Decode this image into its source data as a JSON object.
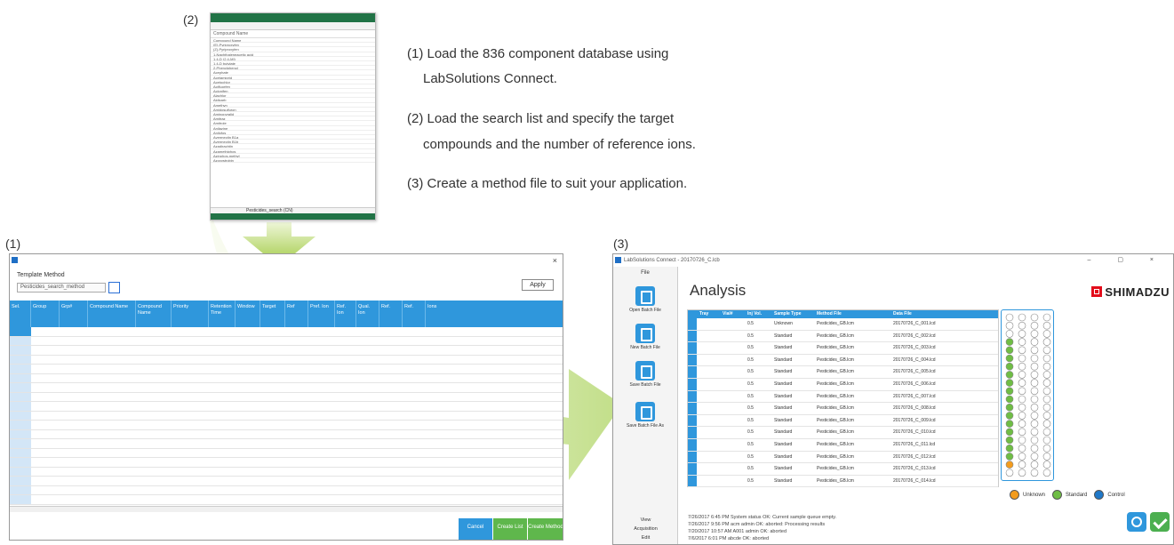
{
  "labels": {
    "l1": "(1)",
    "l2": "(2)",
    "l3": "(3)"
  },
  "steps": [
    "(1) Load the 836 component database using",
    "LabSolutions Connect.",
    "(2) Load the search list and specify the target",
    "compounds and the number of reference ions.",
    "(3) Create a method file to suit your application."
  ],
  "excel": {
    "formula_value": "Compound Name",
    "sheet_tab": "Pesticides_search (CN)",
    "rows": [
      "Compound Name",
      "(E)-Pyriproxyfen",
      "(Z)-Pyriproxyfen",
      "1-Naphthaleneacetic acid",
      "1,4-D (2,4-MI)",
      "1,4-D butylate",
      "2-Phenylphenol",
      "Acephate",
      "Acetamiprid",
      "Acetochlor",
      "Acifluorfen",
      "Aclonifen",
      "Alachlor",
      "Aldicarb",
      "Amethyn",
      "Amidosulfuron",
      "Aminopyralid",
      "Amitraz",
      "Amitrole",
      "Anilazine",
      "Anilofos",
      "Avermectin B1a",
      "Avermectin B1b",
      "Azadirachtin",
      "Azamethiphos",
      "Azinphos-methyl",
      "Azoxystrobin"
    ]
  },
  "win1": {
    "title": "Template Method",
    "select_value": "Pesticides_search_method",
    "button": "Apply",
    "headers": [
      "Sel.",
      "Group",
      "Grp#",
      "Compound Name",
      "Compound Name",
      "Priority",
      "Retention Time",
      "Window",
      "Target",
      "Ref",
      "Pref. Ion",
      "Ref. Ion",
      "Qual. Ion",
      "Ref.",
      "Ref.",
      "Ions"
    ],
    "buttons": [
      "Cancel",
      "Create List",
      "Create Method"
    ]
  },
  "win3": {
    "title": "LabSolutions Connect - 20170726_C.lcb",
    "menu": "File",
    "heading": "Analysis",
    "brand": "SHIMADZU",
    "side_buttons": [
      "Open Batch File",
      "New Batch File",
      "Save Batch File",
      "Save Batch File As"
    ],
    "nav": [
      "View",
      "Acquisition",
      "Edit"
    ],
    "cols": [
      "Tray",
      "Vial#",
      "Inj Vol.",
      "Sample Type",
      "Method File",
      "Data File"
    ],
    "rows": [
      [
        "",
        "",
        "0.5",
        "Unknown",
        "Pesticides_GB.lcm",
        "20170726_C_001.lcd"
      ],
      [
        "",
        "",
        "0.5",
        "Standard",
        "Pesticides_GB.lcm",
        "20170726_C_002.lcd"
      ],
      [
        "",
        "",
        "0.5",
        "Standard",
        "Pesticides_GB.lcm",
        "20170726_C_003.lcd"
      ],
      [
        "",
        "",
        "0.5",
        "Standard",
        "Pesticides_GB.lcm",
        "20170726_C_004.lcd"
      ],
      [
        "",
        "",
        "0.5",
        "Standard",
        "Pesticides_GB.lcm",
        "20170726_C_005.lcd"
      ],
      [
        "",
        "",
        "0.5",
        "Standard",
        "Pesticides_GB.lcm",
        "20170726_C_006.lcd"
      ],
      [
        "",
        "",
        "0.5",
        "Standard",
        "Pesticides_GB.lcm",
        "20170726_C_007.lcd"
      ],
      [
        "",
        "",
        "0.5",
        "Standard",
        "Pesticides_GB.lcm",
        "20170726_C_008.lcd"
      ],
      [
        "",
        "",
        "0.5",
        "Standard",
        "Pesticides_GB.lcm",
        "20170726_C_009.lcd"
      ],
      [
        "",
        "",
        "0.5",
        "Standard",
        "Pesticides_GB.lcm",
        "20170726_C_010.lcd"
      ],
      [
        "",
        "",
        "0.5",
        "Standard",
        "Pesticides_GB.lcm",
        "20170726_C_011.lcd"
      ],
      [
        "",
        "",
        "0.5",
        "Standard",
        "Pesticides_GB.lcm",
        "20170726_C_012.lcd"
      ],
      [
        "",
        "",
        "0.5",
        "Standard",
        "Pesticides_GB.lcm",
        "20170726_C_013.lcd"
      ],
      [
        "",
        "",
        "0.5",
        "Standard",
        "Pesticides_GB.lcm",
        "20170726_C_014.lcd"
      ]
    ],
    "legend": [
      "Unknown",
      "Standard",
      "Control"
    ],
    "log": [
      "7/26/2017 6:45 PM System status OK: Current sample queue empty.",
      "7/26/2017 9:56 PM acm admin OK: aborted: Processing results",
      "7/20/2017 10:57 AM A001 admin OK: aborted",
      "7/6/2017 6:01 PM abcde OK: aborted"
    ]
  }
}
